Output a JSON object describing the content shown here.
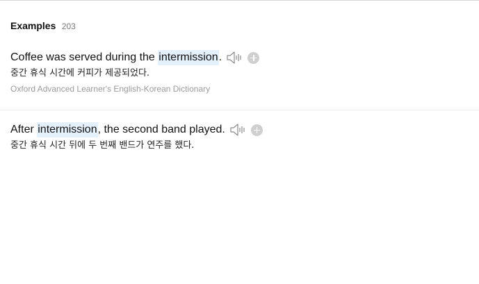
{
  "section": {
    "title": "Examples",
    "count": "203"
  },
  "examples": [
    {
      "pre": "Coffee was served during the ",
      "highlight": "intermission",
      "post": ".",
      "translation": "중간 휴식 시간에 커피가 제공되었다.",
      "source": "Oxford Advanced Learner's English-Korean Dictionary"
    },
    {
      "pre": "After ",
      "highlight": "intermission",
      "post": ", the second band played.",
      "translation": "중간 휴식 시간 뒤에 두 번째 밴드가 연주를 했다."
    }
  ],
  "icons": {
    "speaker": "speaker-icon",
    "add": "add-icon"
  },
  "colors": {
    "highlight_bg": "#e4f1fd",
    "source_text": "#9a9a9a",
    "add_button": "#cfcfcf"
  }
}
